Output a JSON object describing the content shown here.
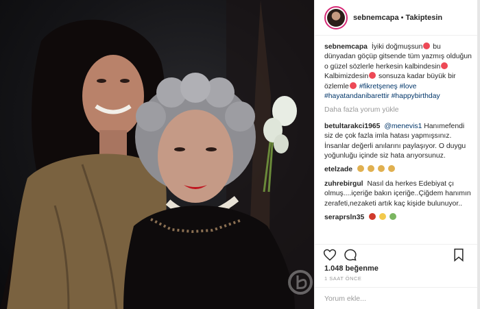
{
  "post": {
    "username": "sebnemcapa",
    "follow_status": "Takiptesin",
    "caption": {
      "user": "sebnemcapa",
      "text_1": "İyiki doğmuşsun",
      "text_2": "bu dünyadan göçüp gitsende tüm yazmış olduğun o güzel sözlerle herkesin kalbindesin",
      "text_3": "Kalbimizdesin",
      "text_4": "sonsuza kadar büyük bir özlemle",
      "hashtags": "#fikretşeneş #love #hayatandanibarettir #happybirthday"
    },
    "load_more": "Daha fazla yorum yükle",
    "comments": [
      {
        "user": "betultarakci1965",
        "mention": "@menevis1",
        "text": "Hanımefendi siz de çok fazla imla hatası yapmışsınız. İnsanlar değerli anılarını paylaşıyor. O duygu yoğunluğu içinde siz hata arıyorsunuz."
      },
      {
        "user": "etelzade",
        "text": ""
      },
      {
        "user": "zuhrebirgul",
        "text": "Nasıl da herkes Edebiyat çı olmuş....içeriğe bakın içeriğe..Çiğdem hanımın zerafeti,nezaketi artık kaç kişide bulunuyor.."
      },
      {
        "user": "seraprsln35",
        "text": ""
      }
    ],
    "likes": "1.048 beğenme",
    "time": "1 SAAT ÖNCE",
    "add_comment_placeholder": "Yorum ekle..."
  },
  "icons": {
    "heart": "heart-icon",
    "comment": "comment-icon",
    "bookmark": "bookmark-icon"
  },
  "colors": {
    "accent_link": "#003569",
    "muted": "#999999",
    "emoji_heart": "#ed4956"
  }
}
